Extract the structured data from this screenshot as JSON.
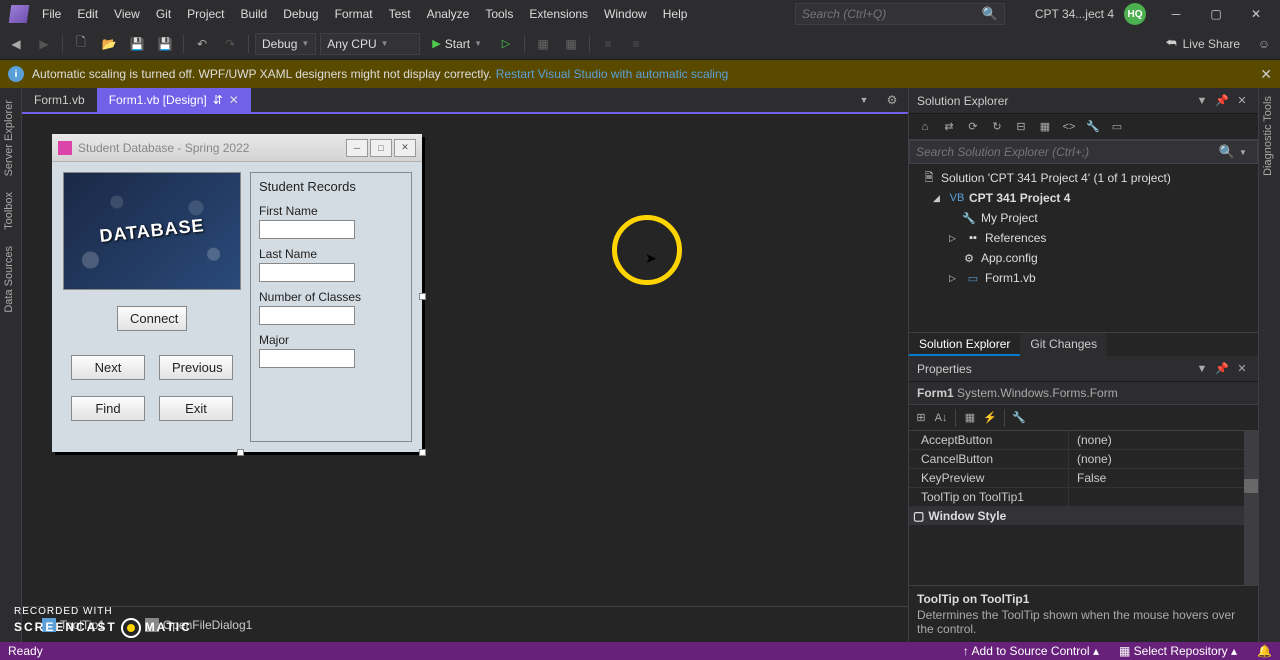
{
  "menu": [
    "File",
    "Edit",
    "View",
    "Git",
    "Project",
    "Build",
    "Debug",
    "Format",
    "Test",
    "Analyze",
    "Tools",
    "Extensions",
    "Window",
    "Help"
  ],
  "search_placeholder": "Search (Ctrl+Q)",
  "title_tab": "CPT 34...ject 4",
  "avatar": "HQ",
  "toolbar": {
    "config": "Debug",
    "platform": "Any CPU",
    "start": "Start",
    "liveshare": "Live Share"
  },
  "infobar": {
    "msg": "Automatic scaling is turned off. WPF/UWP XAML designers might not display correctly.",
    "link": "Restart Visual Studio with automatic scaling"
  },
  "leftrail": [
    "Server Explorer",
    "Toolbox",
    "Data Sources"
  ],
  "tabs": {
    "inactive": "Form1.vb",
    "active": "Form1.vb [Design]"
  },
  "form": {
    "title": "Student Database - Spring 2022",
    "connect": "Connect",
    "next": "Next",
    "previous": "Previous",
    "find": "Find",
    "exit": "Exit",
    "group": "Student Records",
    "first": "First Name",
    "last": "Last Name",
    "classes": "Number of Classes",
    "major": "Major"
  },
  "tray": {
    "tooltip": "ToolTip1",
    "openfile": "OpenFileDialog1"
  },
  "se": {
    "title": "Solution Explorer",
    "search": "Search Solution Explorer (Ctrl+;)",
    "sol": "Solution 'CPT 341 Project 4' (1 of 1 project)",
    "proj": "CPT 341 Project 4",
    "myproj": "My Project",
    "refs": "References",
    "appcfg": "App.config",
    "form": "Form1.vb",
    "tab1": "Solution Explorer",
    "tab2": "Git Changes"
  },
  "props": {
    "title": "Properties",
    "obj_name": "Form1",
    "obj_type": "System.Windows.Forms.Form",
    "rows": [
      {
        "n": "AcceptButton",
        "v": "(none)"
      },
      {
        "n": "CancelButton",
        "v": "(none)"
      },
      {
        "n": "KeyPreview",
        "v": "False"
      },
      {
        "n": "ToolTip on ToolTip1",
        "v": ""
      }
    ],
    "cat": "Window Style",
    "help_name": "ToolTip on ToolTip1",
    "help_text": "Determines the ToolTip shown when the mouse hovers over the control."
  },
  "rightrail": "Diagnostic Tools",
  "status": {
    "ready": "Ready",
    "add_src": "Add to Source Control",
    "sel_repo": "Select Repository"
  },
  "watermark": {
    "l1": "RECORDED WITH",
    "l2a": "SCREENCAST",
    "l2b": "MATIC"
  }
}
